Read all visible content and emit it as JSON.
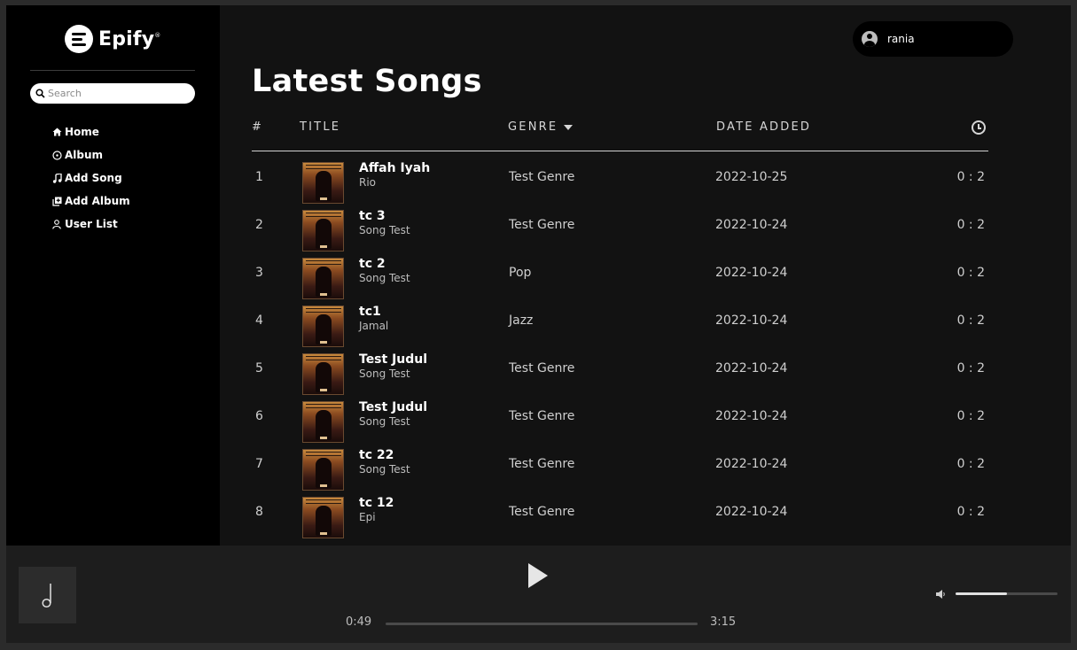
{
  "brand": {
    "name": "Epify",
    "trademark": "®"
  },
  "search": {
    "placeholder": "Search"
  },
  "nav": [
    {
      "label": "Home",
      "icon": "home-icon"
    },
    {
      "label": "Album",
      "icon": "album-icon"
    },
    {
      "label": "Add Song",
      "icon": "music-note-icon"
    },
    {
      "label": "Add Album",
      "icon": "add-album-icon"
    },
    {
      "label": "User List",
      "icon": "user-icon"
    }
  ],
  "user": {
    "name": "rania"
  },
  "page": {
    "title": "Latest Songs"
  },
  "table": {
    "headers": {
      "num": "#",
      "title": "TITLE",
      "genre": "GENRE",
      "date": "DATE ADDED"
    },
    "rows": [
      {
        "num": "1",
        "title": "Affah Iyah",
        "artist": "Rio",
        "genre": "Test Genre",
        "date": "2022-10-25",
        "duration": "0 : 2"
      },
      {
        "num": "2",
        "title": "tc 3",
        "artist": "Song Test",
        "genre": "Test Genre",
        "date": "2022-10-24",
        "duration": "0 : 2"
      },
      {
        "num": "3",
        "title": "tc 2",
        "artist": "Song Test",
        "genre": "Pop",
        "date": "2022-10-24",
        "duration": "0 : 2"
      },
      {
        "num": "4",
        "title": "tc1",
        "artist": "Jamal",
        "genre": "Jazz",
        "date": "2022-10-24",
        "duration": "0 : 2"
      },
      {
        "num": "5",
        "title": "Test Judul",
        "artist": "Song Test",
        "genre": "Test Genre",
        "date": "2022-10-24",
        "duration": "0 : 2"
      },
      {
        "num": "6",
        "title": "Test Judul",
        "artist": "Song Test",
        "genre": "Test Genre",
        "date": "2022-10-24",
        "duration": "0 : 2"
      },
      {
        "num": "7",
        "title": "tc 22",
        "artist": "Song Test",
        "genre": "Test Genre",
        "date": "2022-10-24",
        "duration": "0 : 2"
      },
      {
        "num": "8",
        "title": "tc 12",
        "artist": "Epi",
        "genre": "Test Genre",
        "date": "2022-10-24",
        "duration": "0 : 2"
      }
    ]
  },
  "player": {
    "current_time": "0:49",
    "total_time": "3:15",
    "progress": 0.0,
    "volume": 0.5
  },
  "colors": {
    "background": "#121212",
    "sidebar": "#000000",
    "player": "#1d1d1d",
    "text": "#ffffff",
    "muted": "#cfcfcf"
  }
}
